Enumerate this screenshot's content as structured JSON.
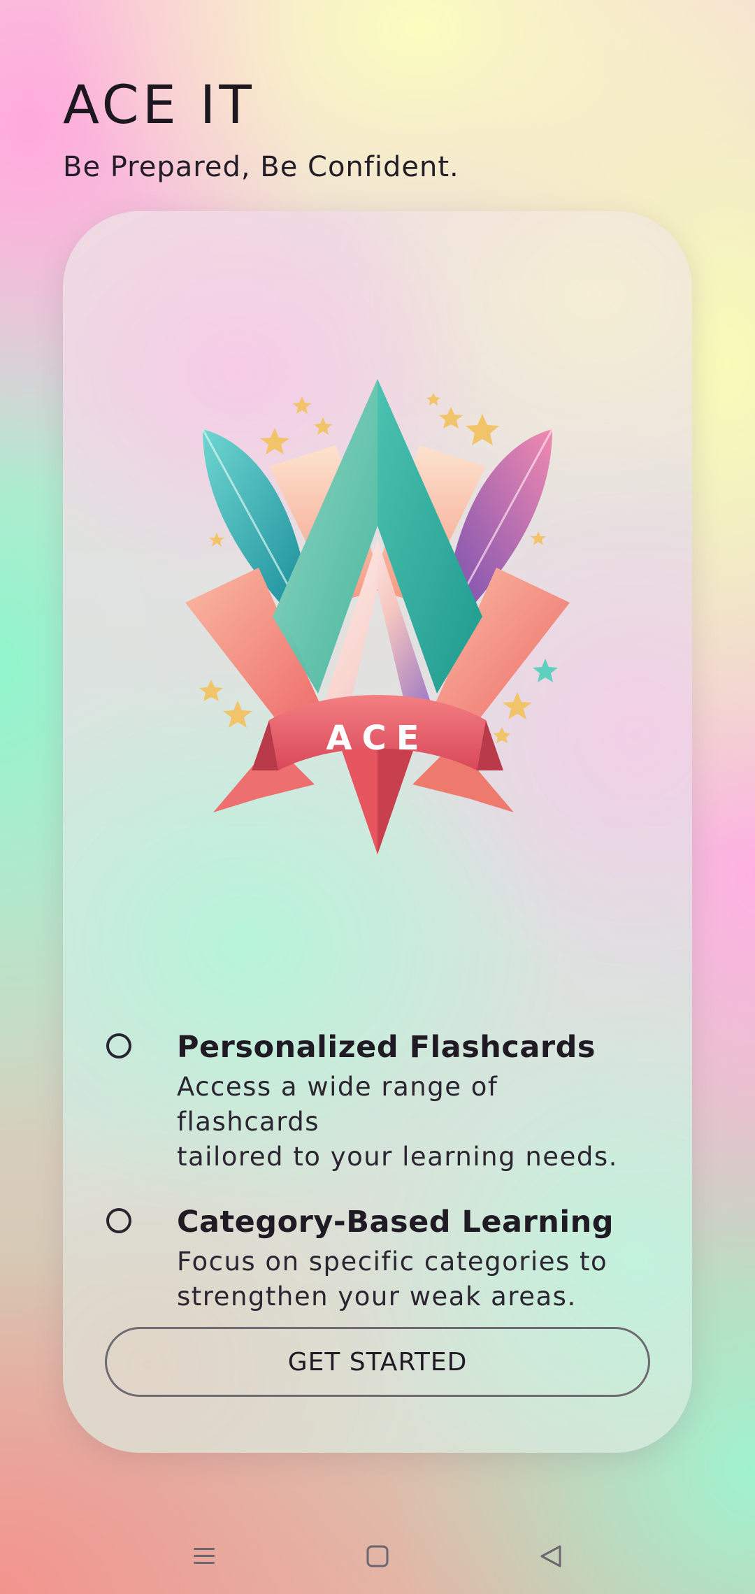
{
  "app": {
    "title": "ACE IT",
    "tagline": "Be Prepared, Be Confident."
  },
  "logo": {
    "banner_text": "ACE"
  },
  "features": [
    {
      "title": "Personalized Flashcards",
      "description_line1": "Access a wide range of flashcards",
      "description_line2": "tailored to your learning needs."
    },
    {
      "title": "Category-Based Learning",
      "description_line1": "Focus on specific categories to",
      "description_line2": "strengthen your weak areas."
    }
  ],
  "cta": {
    "label": "GET STARTED"
  },
  "navbar": {
    "icons": [
      "menu-icon",
      "home-square-icon",
      "back-triangle-icon"
    ]
  },
  "colors": {
    "teal": "#3fb8a6",
    "coral": "#f0787a",
    "pink_feather": "#e57ab4",
    "gold_star": "#f2c46a"
  }
}
